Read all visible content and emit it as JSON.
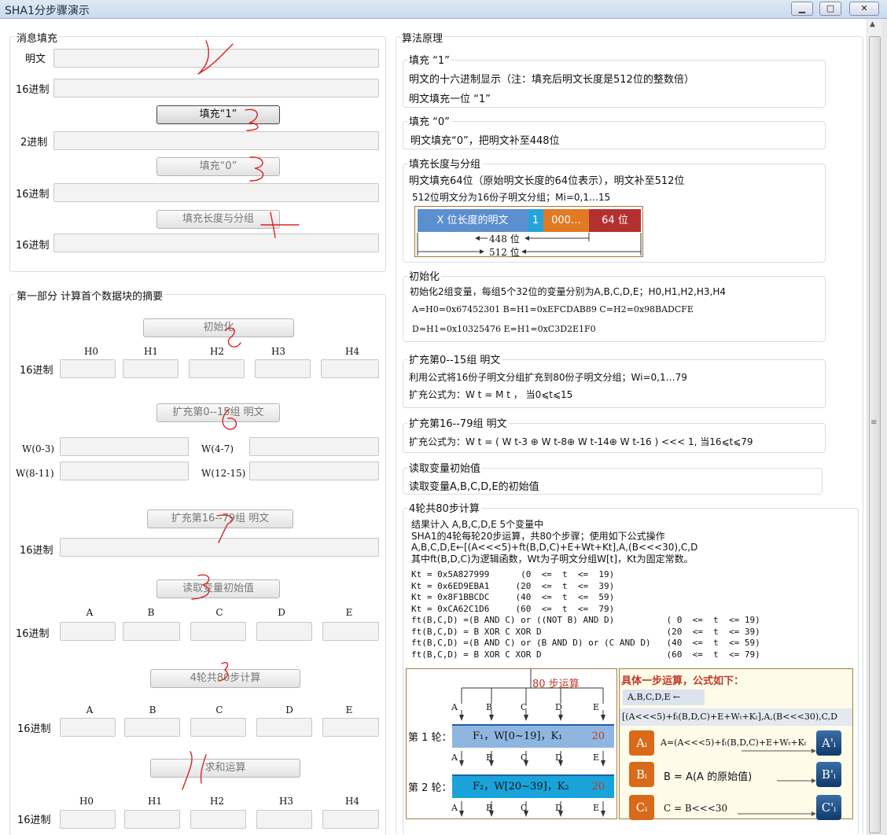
{
  "window": {
    "title": "SHA1分步骤演示",
    "min": "▁",
    "max": "□",
    "close": "✕"
  },
  "left_top": {
    "title": "消息填充",
    "labels": [
      "明文",
      "16进制",
      "2进制",
      "16进制",
      "16进制"
    ],
    "btn_pad1": "填充“1”",
    "btn_pad0": "填充“0”",
    "btn_len": "填充长度与分组"
  },
  "left_bottom": {
    "title": "第一部分 计算首个数据块的摘要",
    "btn_init": "初始化",
    "btn_expand1": "扩充第0--15组 明文",
    "btn_expand2": "扩充第16--79组 明文",
    "btn_read": "读取变量初始值",
    "btn_rounds": "4轮共80步计算",
    "btn_sum": "求和运算",
    "hdr_h": [
      "H0",
      "H1",
      "H2",
      "H3",
      "H4"
    ],
    "hdr_abc": [
      "A",
      "B",
      "C",
      "D",
      "E"
    ],
    "label_hex": "16进制",
    "w_labels": [
      "W(0-3)",
      "W(4-7)",
      "W(8-11)",
      "W(12-15)"
    ]
  },
  "right": {
    "title": "算法原理",
    "s1_title": "填充 “1”",
    "s1_l1": "明文的十六进制显示（注：填充后明文长度是512位的整数倍）",
    "s1_l2": "明文填充一位 “1”",
    "s2_title": "填充 “0”",
    "s2_l1": "明文填充“0”，把明文补至448位",
    "s3_title": "填充长度与分组",
    "s3_l1": "明文填充64位（原始明文长度的64位表示），明文补至512位",
    "s3_l2": "512位明文分为16份子明文分组；Mi=0,1…15",
    "s3_seg1": "X 位长度的明文",
    "s3_seg2": "1",
    "s3_seg3": "000…",
    "s3_seg4": "64 位",
    "s3_448": "448 位",
    "s3_512": "512 位",
    "s4_title": "初始化",
    "s4_l1": "初始化2组变量，每组5个32位的变量分别为A,B,C,D,E；H0,H1,H2,H3,H4",
    "s4_l2": "A=H0=0x67452301 B=H1=0xEFCDAB89 C=H2=0x98BADCFE",
    "s4_l3": "D=H1=0x10325476 E=H1=0xC3D2E1F0",
    "s5_title": "扩充第0--15组 明文",
    "s5_l1": "利用公式将16份子明文分组扩充到80份子明文分组；Wi=0,1…79",
    "s5_l2": "扩充公式为：W t = M t ， 当0⩽t⩽15",
    "s6_title": "扩充第16--79组 明文",
    "s6_l1": "扩充公式为：W t = ( W t-3 ⊕ W t-8⊕ W t-14⊕ W t-16 ) <<< 1, 当16⩽t⩽79",
    "s7_title": "读取变量初始值",
    "s7_l1": "读取变量A,B,C,D,E的初始值",
    "s8_title": "4轮共80步计算",
    "s8_text": "结果计入 A,B,C,D,E 5个变量中\nSHA1的4轮每轮20步运算，共80个步骤；使用如下公式操作\nA,B,C,D,E←[(A<<<5)+ft(B,D,C)+E+Wt+Kt],A,(B<<<30),C,D\n其中ft(B,D,C)为逻辑函数，Wt为子明文分组W[t]，Kt为固定常数。",
    "s8_consts": "Kt = 0x5A827999      (0  <=  t  <=  19)\nKt = 0x6ED9EBA1     (20  <=  t  <=  39)\nKt = 0x8F1BBCDC     (40  <=  t  <=  59)\nKt = 0xCA62C1D6     (60  <=  t  <=  79)\nft(B,C,D) =(B AND C) or ((NOT B) AND D)          ( 0  <=  t  <= 19)\nft(B,C,D) = B XOR C XOR D                        (20  <=  t  <= 39)\nft(B,C,D) =(B AND C) or (B AND D) or (C AND D)   (40  <=  t  <= 59)\nft(B,C,D) = B XOR C XOR D                        (60  <=  t  <= 79)",
    "rounds_title": "80 步运算",
    "round1": "第 1 轮：",
    "round2": "第 2 轮：",
    "round1_bar": "F₁，W[0~19]，K₁",
    "round2_bar": "F₂，W[20~39]，K₂",
    "round_count": "20",
    "letters": [
      "A",
      "B",
      "C",
      "D",
      "E"
    ],
    "step_title": "具体一步运算，公式如下：",
    "step_l1": "A,B,C,D,E ←",
    "step_l2": "[(A<<<5)+fₜ(B,D,C)+E+Wₜ+Kₜ],A,(B<<<30),C,D",
    "step_a": "Aᵢ",
    "step_b": "Bᵢ",
    "step_c": "Cᵢ",
    "step_fa": "A=(A<<<5)+fₜ(B,D,C)+E+Wₜ+Kₜ",
    "step_fb": "B = A(A 的原始值)",
    "step_fc": "C = B<<<30",
    "step_oa": "A'ᵢ",
    "step_ob": "B'ᵢ",
    "step_oc": "C'ᵢ"
  },
  "colors": {
    "seg_blue": "#5b8fcf",
    "seg_cyan": "#27a3d9",
    "seg_orange": "#e07a24",
    "seg_red": "#b43030",
    "bar_blue": "#8fb6e0",
    "bar_cyan": "#1aa3d9",
    "step_orange": "#d86a1a",
    "scribble_red": "#d22"
  }
}
